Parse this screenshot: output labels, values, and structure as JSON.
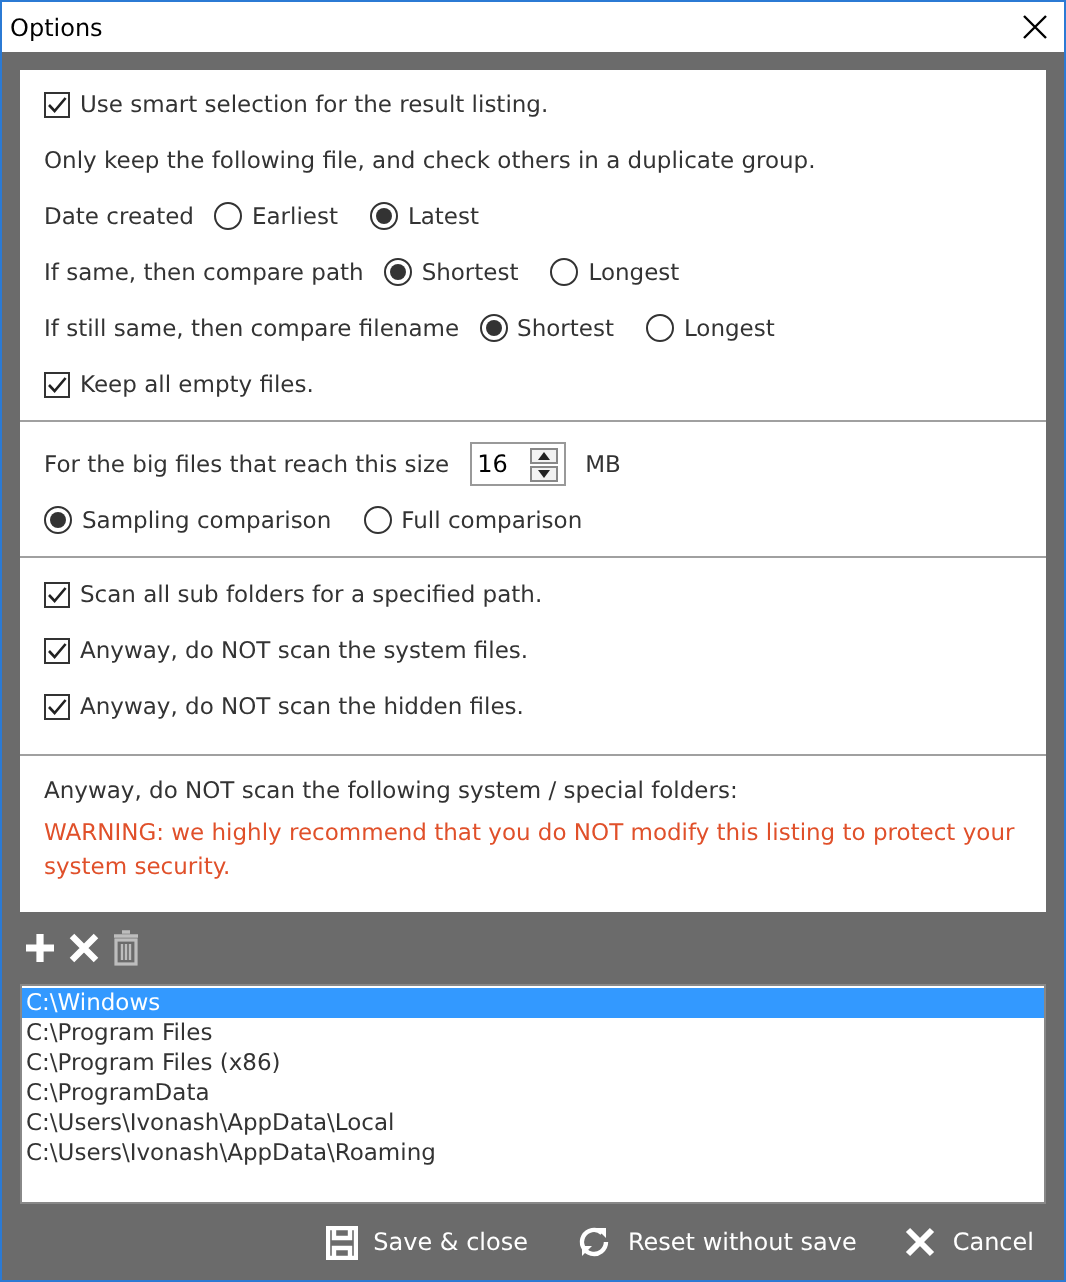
{
  "window": {
    "title": "Options"
  },
  "smart_selection": {
    "label": "Use smart selection for the result listing.",
    "checked": true
  },
  "intro": "Only keep the following file, and check others in a duplicate group.",
  "criteria": [
    {
      "label": "Date created",
      "options": [
        {
          "label": "Earliest",
          "selected": false
        },
        {
          "label": "Latest",
          "selected": true
        }
      ]
    },
    {
      "label": "If same, then compare path",
      "options": [
        {
          "label": "Shortest",
          "selected": true
        },
        {
          "label": "Longest",
          "selected": false
        }
      ]
    },
    {
      "label": "If still same, then compare filename",
      "options": [
        {
          "label": "Shortest",
          "selected": true
        },
        {
          "label": "Longest",
          "selected": false
        }
      ]
    }
  ],
  "keep_empty": {
    "label": "Keep all empty files.",
    "checked": true
  },
  "size": {
    "label": "For the big files that reach this size",
    "value": "16",
    "unit": "MB"
  },
  "compare_modes": [
    {
      "label": "Sampling comparison",
      "selected": true
    },
    {
      "label": "Full comparison",
      "selected": false
    }
  ],
  "scan_options": [
    {
      "label": "Scan all sub folders for a specified path.",
      "checked": true
    },
    {
      "label": "Anyway, do NOT scan the system files.",
      "checked": true
    },
    {
      "label": "Anyway, do NOT scan the hidden files.",
      "checked": true
    }
  ],
  "folders_note": "Anyway, do NOT scan the following system / special folders:",
  "warning": "WARNING: we highly recommend that you do NOT modify this listing to protect your system security.",
  "toolbar": [
    {
      "kind": "add",
      "disabled": false
    },
    {
      "kind": "remove",
      "disabled": false
    },
    {
      "kind": "clear",
      "disabled": true
    }
  ],
  "folders": [
    {
      "path": "C:\\Windows",
      "selected": true
    },
    {
      "path": "C:\\Program Files",
      "selected": false
    },
    {
      "path": "C:\\Program Files (x86)",
      "selected": false
    },
    {
      "path": "C:\\ProgramData",
      "selected": false
    },
    {
      "path": "C:\\Users\\Ivonash\\AppData\\Local",
      "selected": false
    },
    {
      "path": "C:\\Users\\Ivonash\\AppData\\Roaming",
      "selected": false
    }
  ],
  "buttons": [
    {
      "kind": "save",
      "label": "Save & close"
    },
    {
      "kind": "reset",
      "label": "Reset without save"
    },
    {
      "kind": "cancel",
      "label": "Cancel"
    }
  ]
}
